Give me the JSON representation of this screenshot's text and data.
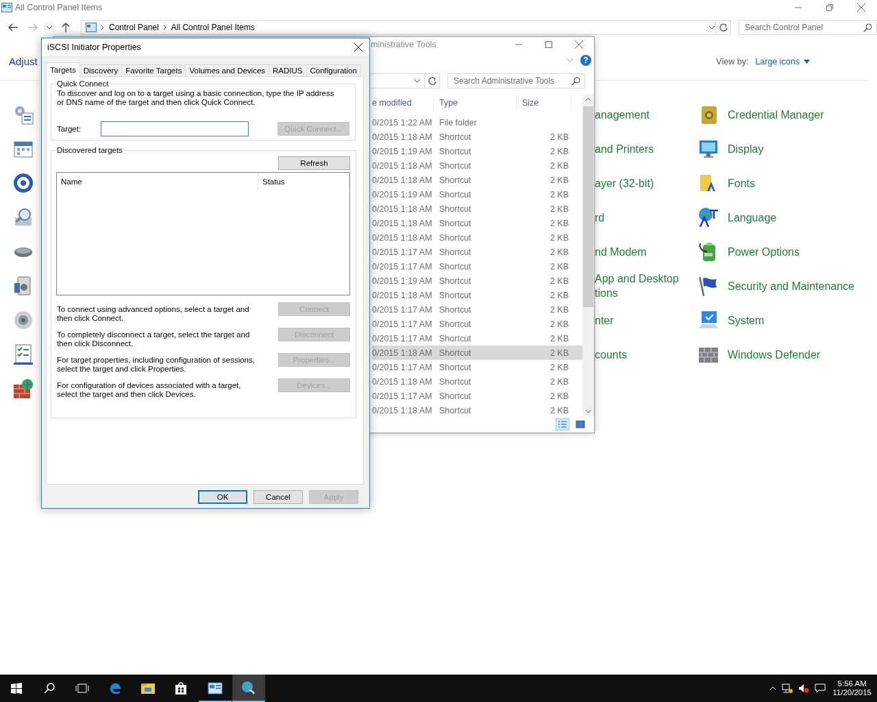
{
  "control_panel": {
    "title": "All Control Panel Items",
    "breadcrumb": [
      "Control Panel",
      "All Control Panel Items"
    ],
    "search": {
      "placeholder": "Search Control Panel"
    },
    "heading": "Adjust",
    "view_by": {
      "label": "View by:",
      "value": "Large icons"
    },
    "partial_items": [
      {
        "label": "anagement"
      },
      {
        "label": "and Printers"
      },
      {
        "label": "ayer (32-bit)"
      },
      {
        "label": "rd"
      },
      {
        "label": "nd Modem"
      },
      {
        "label": "App and Desktop\ntions"
      },
      {
        "label": "nter"
      },
      {
        "label": "counts"
      }
    ],
    "items": [
      {
        "label": "Credential Manager"
      },
      {
        "label": "Display"
      },
      {
        "label": "Fonts"
      },
      {
        "label": "Language"
      },
      {
        "label": "Power Options"
      },
      {
        "label": "Security and Maintenance"
      },
      {
        "label": "System"
      },
      {
        "label": "Windows Defender"
      }
    ]
  },
  "admin_tools": {
    "title": "ministrative Tools",
    "help": "?",
    "search": {
      "placeholder": "Search Administrative Tools"
    },
    "columns": [
      "e modified",
      "Type",
      "Size"
    ],
    "rows": [
      {
        "date": "0/2015 1:22 AM",
        "type": "File folder",
        "selected": false
      },
      {
        "date": "0/2015 1:18 AM",
        "type": "Shortcut",
        "size": "2 KB",
        "selected": false
      },
      {
        "date": "0/2015 1:19 AM",
        "type": "Shortcut",
        "size": "2 KB",
        "selected": false
      },
      {
        "date": "0/2015 1:18 AM",
        "type": "Shortcut",
        "size": "2 KB",
        "selected": false
      },
      {
        "date": "0/2015 1:18 AM",
        "type": "Shortcut",
        "size": "2 KB",
        "selected": false
      },
      {
        "date": "0/2015 1:19 AM",
        "type": "Shortcut",
        "size": "2 KB",
        "selected": false
      },
      {
        "date": "0/2015 1:18 AM",
        "type": "Shortcut",
        "size": "2 KB",
        "selected": false
      },
      {
        "date": "0/2015 1:18 AM",
        "type": "Shortcut",
        "size": "2 KB",
        "selected": false
      },
      {
        "date": "0/2015 1:18 AM",
        "type": "Shortcut",
        "size": "2 KB",
        "selected": false
      },
      {
        "date": "0/2015 1:17 AM",
        "type": "Shortcut",
        "size": "2 KB",
        "selected": false
      },
      {
        "date": "0/2015 1:17 AM",
        "type": "Shortcut",
        "size": "2 KB",
        "selected": false
      },
      {
        "date": "0/2015 1:19 AM",
        "type": "Shortcut",
        "size": "2 KB",
        "selected": false
      },
      {
        "date": "0/2015 1:18 AM",
        "type": "Shortcut",
        "size": "2 KB",
        "selected": false
      },
      {
        "date": "0/2015 1:17 AM",
        "type": "Shortcut",
        "size": "2 KB",
        "selected": false
      },
      {
        "date": "0/2015 1:17 AM",
        "type": "Shortcut",
        "size": "2 KB",
        "selected": false
      },
      {
        "date": "0/2015 1:17 AM",
        "type": "Shortcut",
        "size": "2 KB",
        "selected": false
      },
      {
        "date": "0/2015 1:18 AM",
        "type": "Shortcut",
        "size": "2 KB",
        "selected": true
      },
      {
        "date": "0/2015 1:17 AM",
        "type": "Shortcut",
        "size": "2 KB",
        "selected": false
      },
      {
        "date": "0/2015 1:18 AM",
        "type": "Shortcut",
        "size": "2 KB",
        "selected": false
      },
      {
        "date": "0/2015 1:17 AM",
        "type": "Shortcut",
        "size": "2 KB",
        "selected": false
      },
      {
        "date": "0/2015 1:18 AM",
        "type": "Shortcut",
        "size": "2 KB",
        "selected": false
      }
    ]
  },
  "dialog": {
    "title": "iSCSI Initiator Properties",
    "tabs": [
      {
        "label": "Targets",
        "selected": true
      },
      {
        "label": "Discovery",
        "selected": false
      },
      {
        "label": "Favorite Targets",
        "selected": false
      },
      {
        "label": "Volumes and Devices",
        "selected": false
      },
      {
        "label": "RADIUS",
        "selected": false
      },
      {
        "label": "Configuration",
        "selected": false
      }
    ],
    "quick_connect": {
      "legend": "Quick Connect",
      "description": "To discover and log on to a target using a basic connection, type the IP address or DNS name of the target and then click Quick Connect.",
      "target_label": "Target:",
      "button": {
        "label": "Quick Connect...",
        "disabled": true
      }
    },
    "discovered": {
      "legend": "Discovered targets",
      "refresh": {
        "label": "Refresh",
        "disabled": false
      },
      "columns": [
        "Name",
        "Status"
      ],
      "actions": [
        {
          "text": "To connect using advanced options, select a target and then click Connect.",
          "button": {
            "label": "Connect",
            "disabled": true
          }
        },
        {
          "text": "To completely disconnect a target, select the target and then click Disconnect.",
          "button": {
            "label": "Disconnect",
            "disabled": true
          }
        },
        {
          "text": "For target properties, including configuration of sessions, select the target and click Properties.",
          "button": {
            "label": "Properties...",
            "disabled": true
          }
        },
        {
          "text": "For configuration of devices associated with a target, select the target and then click Devices.",
          "button": {
            "label": "Devices...",
            "disabled": true
          }
        }
      ]
    },
    "buttons": [
      {
        "label": "OK",
        "default": true,
        "disabled": false
      },
      {
        "label": "Cancel",
        "default": false,
        "disabled": false
      },
      {
        "label": "Apply",
        "default": false,
        "disabled": true
      }
    ]
  },
  "taskbar": {
    "apps": [
      {
        "kind": "start",
        "running": false,
        "selected": false
      },
      {
        "kind": "search",
        "running": false,
        "selected": false
      },
      {
        "kind": "task_view",
        "running": false,
        "selected": false
      },
      {
        "kind": "edge",
        "running": false,
        "selected": false
      },
      {
        "kind": "explorer",
        "running": false,
        "selected": false
      },
      {
        "kind": "store",
        "running": false,
        "selected": false
      },
      {
        "kind": "control_panel",
        "running": true,
        "selected": false
      },
      {
        "kind": "iscsi",
        "running": true,
        "selected": true
      }
    ],
    "time": "5:56 AM",
    "date": "11/20/2015"
  }
}
